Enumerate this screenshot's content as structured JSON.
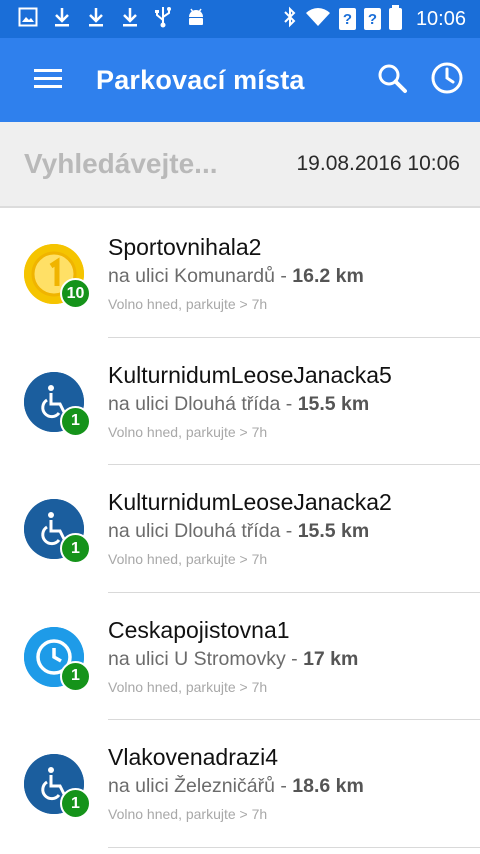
{
  "status_bar": {
    "time": "10:06",
    "left_icons": [
      "image-icon",
      "download-icon",
      "download-icon",
      "download-icon",
      "usb-icon",
      "android-icon"
    ],
    "right_icons": [
      "bluetooth-icon",
      "wifi-icon",
      "unknown-sim-icon",
      "unknown-sim-icon",
      "battery-icon"
    ],
    "unknown_sim_glyph": "?"
  },
  "app_bar": {
    "title": "Parkovací místa",
    "menu_icon": "menu-icon",
    "search_icon": "search-icon",
    "history_icon": "clock-icon",
    "color": "#2f80ed"
  },
  "search": {
    "placeholder": "Vyhledávejte...",
    "value": "",
    "datetime": "19.08.2016 10:06"
  },
  "parking_list": [
    {
      "name": "Sportovnihala2",
      "street": "na ulici Komunardů - ",
      "distance": "16.2 km",
      "status": "Volno hned, parkujte > 7h",
      "icon": "coin-icon",
      "badge": "10"
    },
    {
      "name": "KulturnidumLeoseJanacka5",
      "street": "na ulici Dlouhá třída - ",
      "distance": "15.5 km",
      "status": "Volno hned, parkujte > 7h",
      "icon": "wheelchair-icon",
      "badge": "1"
    },
    {
      "name": "KulturnidumLeoseJanacka2",
      "street": "na ulici Dlouhá třída - ",
      "distance": "15.5 km",
      "status": "Volno hned, parkujte > 7h",
      "icon": "wheelchair-icon",
      "badge": "1"
    },
    {
      "name": "Ceskapojistovna1",
      "street": "na ulici U Stromovky - ",
      "distance": "17 km",
      "status": "Volno hned, parkujte > 7h",
      "icon": "clock-zone-icon",
      "badge": "1"
    },
    {
      "name": "Vlakovenadrazi4",
      "street": "na ulici Železničářů - ",
      "distance": "18.6 km",
      "status": "Volno hned, parkujte > 7h",
      "icon": "wheelchair-icon",
      "badge": "1"
    }
  ],
  "colors": {
    "status_bar": "#1a6ed8",
    "app_bar": "#2f80ed",
    "badge": "#15931a",
    "coin": "#f5c400",
    "wheelchair": "#1b5e9e",
    "clock_zone": "#1e9be8"
  }
}
